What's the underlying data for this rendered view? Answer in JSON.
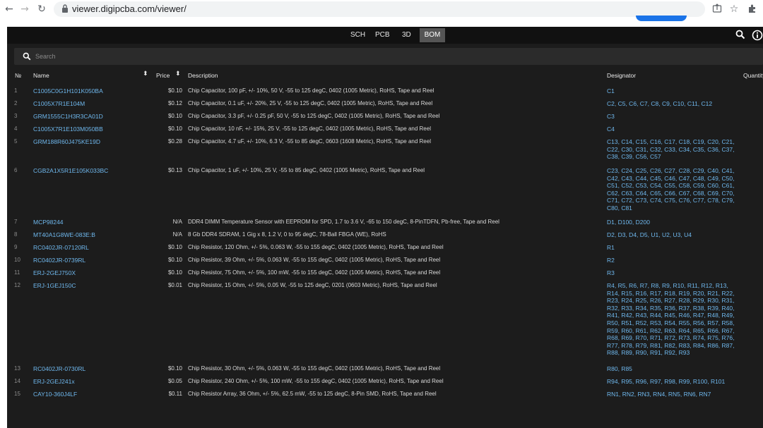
{
  "browser": {
    "url": "viewer.digipcba.com/viewer/"
  },
  "nav": {
    "tabs": [
      {
        "label": "SCH",
        "active": false
      },
      {
        "label": "PCB",
        "active": false
      },
      {
        "label": "3D",
        "active": false
      },
      {
        "label": "BOM",
        "active": true
      }
    ]
  },
  "search": {
    "placeholder": "Search"
  },
  "table": {
    "headers": {
      "num": "№",
      "name": "Name",
      "price": "Price",
      "description": "Description",
      "designator": "Designator",
      "quantity": "Quantity"
    },
    "rows": [
      {
        "num": "1",
        "name": "C1005C0G1H101K050BA",
        "price": "$0.10",
        "description": "Chip Capacitor, 100 pF, +/- 10%, 50 V, -55 to 125 degC, 0402 (1005 Metric), RoHS, Tape and Reel",
        "designator": "C1"
      },
      {
        "num": "2",
        "name": "C1005X7R1E104M",
        "price": "$0.12",
        "description": "Chip Capacitor, 0.1 uF, +/- 20%, 25 V, -55 to 125 degC, 0402 (1005 Metric), RoHS, Tape and Reel",
        "designator": "C2, C5, C6, C7, C8, C9, C10, C11, C12"
      },
      {
        "num": "3",
        "name": "GRM1555C1H3R3CA01D",
        "price": "$0.10",
        "description": "Chip Capacitor, 3.3 pF, +/- 0.25 pF, 50 V, -55 to 125 degC, 0402 (1005 Metric), RoHS, Tape and Reel",
        "designator": "C3"
      },
      {
        "num": "4",
        "name": "C1005X7R1E103M050BB",
        "price": "$0.10",
        "description": "Chip Capacitor, 10 nF, +/- 15%, 25 V, -55 to 125 degC, 0402 (1005 Metric), RoHS, Tape and Reel",
        "designator": "C4"
      },
      {
        "num": "5",
        "name": "GRM188R60J475KE19D",
        "price": "$0.28",
        "description": "Chip Capacitor, 4.7 uF, +/- 10%, 6.3 V, -55 to 85 degC, 0603 (1608 Metric), RoHS, Tape and Reel",
        "designator": "C13, C14, C15, C16, C17, C18, C19, C20, C21, C22, C30, C31, C32, C33, C34, C35, C36, C37, C38, C39, C56, C57"
      },
      {
        "num": "6",
        "name": "CGB2A1X5R1E105K033BC",
        "price": "$0.13",
        "description": "Chip Capacitor, 1 uF, +/- 10%, 25 V, -55 to 85 degC, 0402 (1005 Metric), RoHS, Tape and Reel",
        "designator": "C23, C24, C25, C26, C27, C28, C29, C40, C41, C42, C43, C44, C45, C46, C47, C48, C49, C50, C51, C52, C53, C54, C55, C58, C59, C60, C61, C62, C63, C64, C65, C66, C67, C68, C69, C70, C71, C72, C73, C74, C75, C76, C77, C78, C79, C80, C81"
      },
      {
        "num": "7",
        "name": "MCP98244",
        "price": "N/A",
        "description": "DDR4 DIMM Temperature Sensor with EEPROM for SPD, 1.7 to 3.6 V, -65 to 150 degC, 8-PinTDFN, Pb-free, Tape and Reel",
        "designator": "D1, D100, D200"
      },
      {
        "num": "8",
        "name": "MT40A1G8WE-083E:B",
        "price": "N/A",
        "description": "8 Gb DDR4 SDRAM, 1 Gig x 8, 1.2 V, 0 to 95 degC, 78-Ball FBGA (WE), RoHS",
        "designator": "D2, D3, D4, D5, U1, U2, U3, U4"
      },
      {
        "num": "9",
        "name": "RC0402JR-07120RL",
        "price": "$0.10",
        "description": "Chip Resistor, 120 Ohm, +/- 5%, 0.063 W, -55 to 155 degC, 0402 (1005 Metric), RoHS, Tape and Reel",
        "designator": "R1"
      },
      {
        "num": "10",
        "name": "RC0402JR-0739RL",
        "price": "$0.10",
        "description": "Chip Resistor, 39 Ohm, +/- 5%, 0.063 W, -55 to 155 degC, 0402 (1005 Metric), RoHS, Tape and Reel",
        "designator": "R2"
      },
      {
        "num": "11",
        "name": "ERJ-2GEJ750X",
        "price": "$0.10",
        "description": "Chip Resistor, 75 Ohm, +/- 5%, 100 mW, -55 to 155 degC, 0402 (1005 Metric), RoHS, Tape and Reel",
        "designator": "R3"
      },
      {
        "num": "12",
        "name": "ERJ-1GEJ150C",
        "price": "$0.01",
        "description": "Chip Resistor, 15 Ohm, +/- 5%, 0.05 W, -55 to 125 degC, 0201 (0603 Metric), RoHS, Tape and Reel",
        "designator": "R4, R5, R6, R7, R8, R9, R10, R11, R12, R13, R14, R15, R16, R17, R18, R19, R20, R21, R22, R23, R24, R25, R26, R27, R28, R29, R30, R31, R32, R33, R34, R35, R36, R37, R38, R39, R40, R41, R42, R43, R44, R45, R46, R47, R48, R49, R50, R51, R52, R53, R54, R55, R56, R57, R58, R59, R60, R61, R62, R63, R64, R65, R66, R67, R68, R69, R70, R71, R72, R73, R74, R75, R76, R77, R78, R79, R81, R82, R83, R84, R86, R87, R88, R89, R90, R91, R92, R93"
      },
      {
        "num": "13",
        "name": "RC0402JR-0730RL",
        "price": "$0.10",
        "description": "Chip Resistor, 30 Ohm, +/- 5%, 0.063 W, -55 to 155 degC, 0402 (1005 Metric), RoHS, Tape and Reel",
        "designator": "R80, R85"
      },
      {
        "num": "14",
        "name": "ERJ-2GEJ241x",
        "price": "$0.05",
        "description": "Chip Resistor, 240 Ohm, +/- 5%, 100 mW, -55 to 155 degC, 0402 (1005 Metric), RoHS, Tape and Reel",
        "designator": "R94, R95, R96, R97, R98, R99, R100, R101"
      },
      {
        "num": "15",
        "name": "CAY10-360J4LF",
        "price": "$0.11",
        "description": "Chip Resistor Array, 36 Ohm, +/- 5%, 62.5 mW, -55 to 125 degC, 8-Pin SMD, RoHS, Tape and Reel",
        "designator": "RN1, RN2, RN3, RN4, RN5, RN6, RN7"
      }
    ]
  }
}
